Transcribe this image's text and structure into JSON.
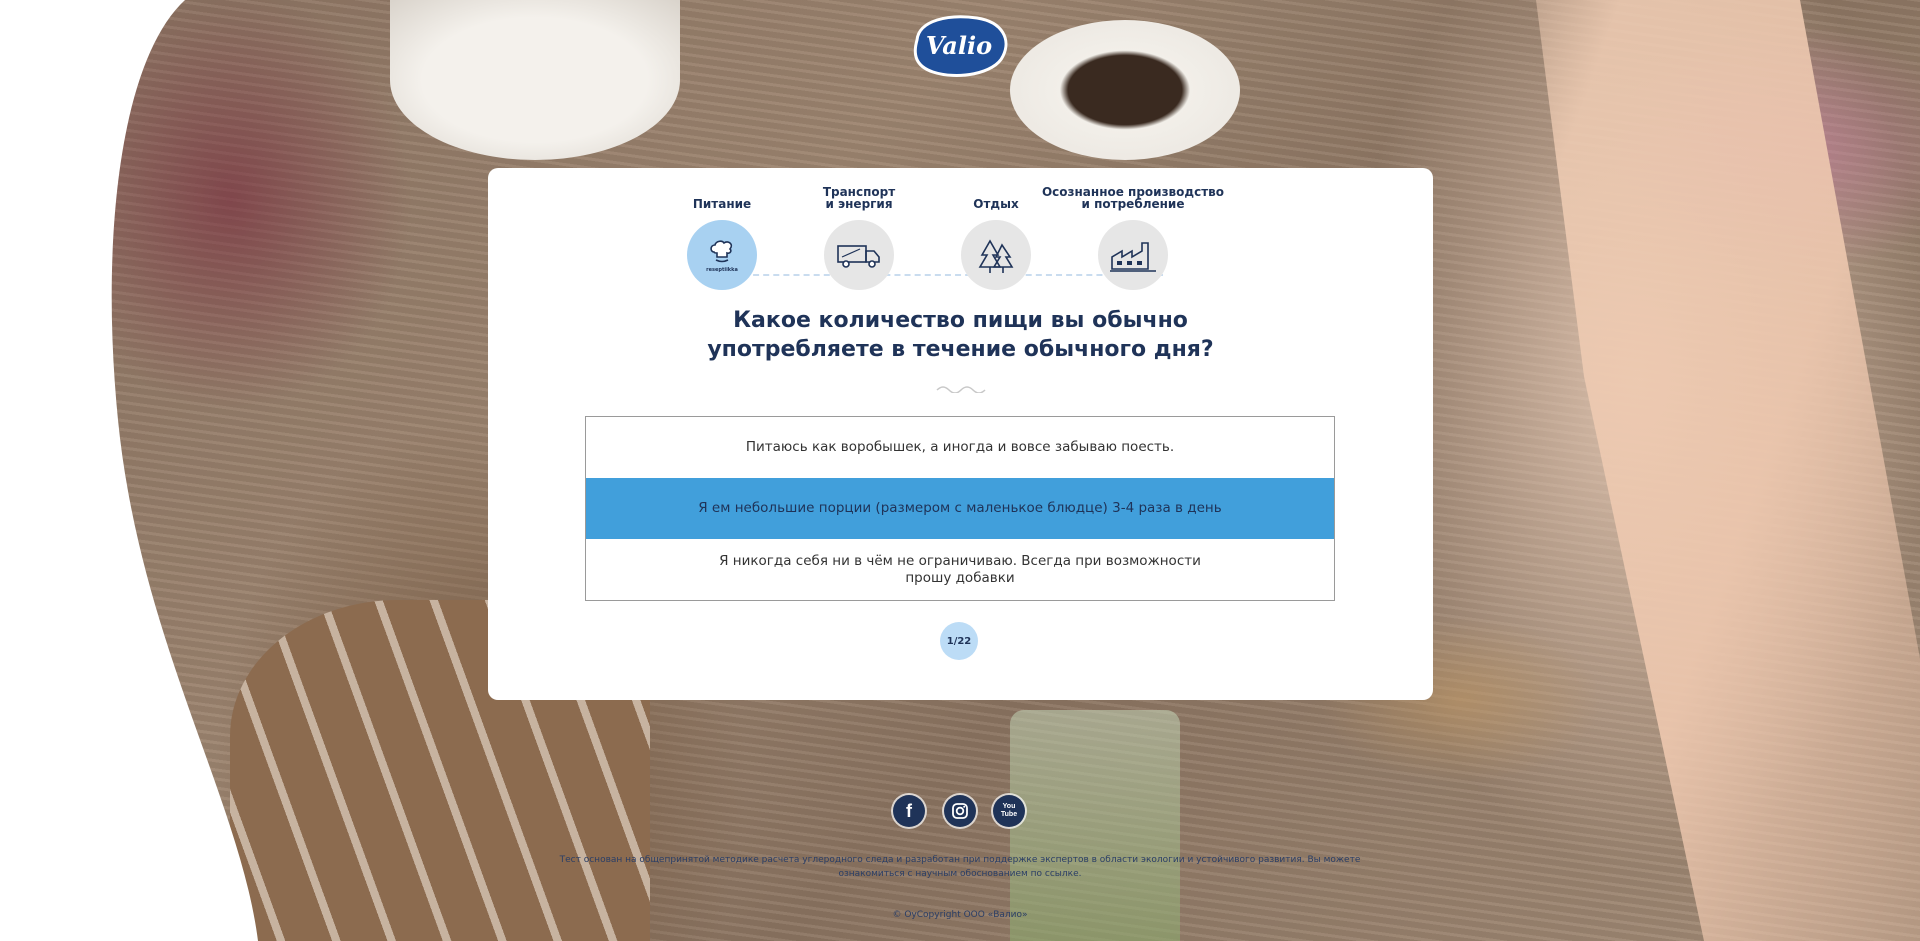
{
  "brand": {
    "logo_text": "Valio",
    "primary_color": "#1f3358",
    "accent_color": "#419fdb"
  },
  "steps": [
    {
      "label": "Питание",
      "icon": "chef-hat-icon",
      "icon_caption": "reseptiikka",
      "active": true
    },
    {
      "label": "Транспорт\nи энергия",
      "icon": "truck-icon",
      "active": false
    },
    {
      "label": "Отдых",
      "icon": "trees-icon",
      "active": false
    },
    {
      "label": "Осознанное производство\nи потребление",
      "icon": "factory-icon",
      "active": false
    }
  ],
  "question": {
    "line1": "Какое количество пищи вы обычно",
    "line2": "употребляете в течение обычного дня?"
  },
  "answers": [
    {
      "lines": [
        "Питаюсь как воробышек, а иногда и вовсе забываю поесть."
      ],
      "selected": false
    },
    {
      "lines": [
        "Я ем небольшие порции (размером с маленькое блюдце) 3-4 раза в день"
      ],
      "selected": true
    },
    {
      "lines": [
        "Я никогда себя ни в чём не ограничиваю. Всегда при возможности",
        "прошу добавки"
      ],
      "selected": false
    }
  ],
  "progress": {
    "label": "1/22",
    "current": 1,
    "total": 22
  },
  "social": [
    {
      "name": "facebook",
      "glyph": "f",
      "icon": "facebook-icon"
    },
    {
      "name": "instagram",
      "glyph": "◎",
      "icon": "instagram-icon"
    },
    {
      "name": "youtube",
      "glyph": "You Tube",
      "icon": "youtube-icon"
    }
  ],
  "footer": {
    "line1": "Тест основан на общепринятой методике расчета углеродного следа и разработан при поддержке экспертов в области экологии и устойчивого развития. Вы можете",
    "line2": "ознакомиться с научным обоснованием по ссылке.",
    "copyright": "© OyCopyright ООО «Валио»"
  }
}
